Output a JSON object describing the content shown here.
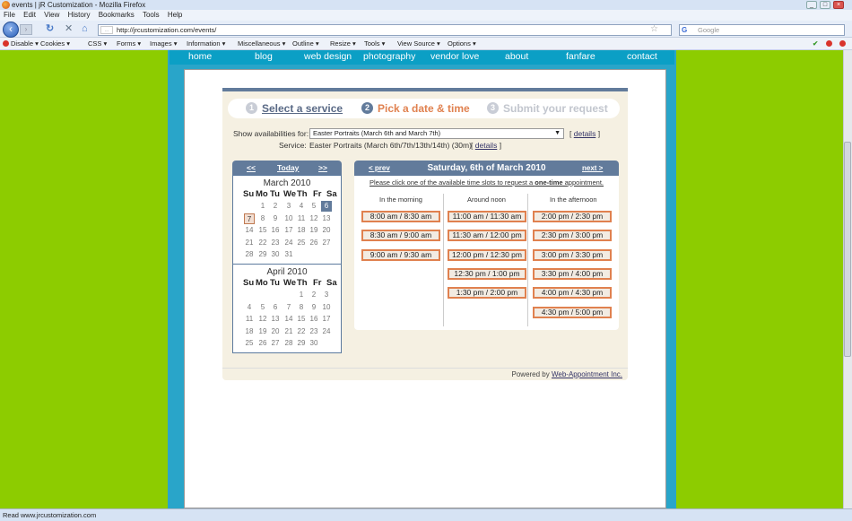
{
  "window": {
    "title": "events | jR Customization - Mozilla Firefox"
  },
  "menu": [
    "File",
    "Edit",
    "View",
    "History",
    "Bookmarks",
    "Tools",
    "Help"
  ],
  "nav": {
    "url": "http://jrcustomization.com/events/",
    "fav_label": "...",
    "search_placeholder": "Google",
    "search_engine_letter": "G"
  },
  "devbar": {
    "items": [
      "Disable",
      "Cookies",
      "CSS",
      "Forms",
      "Images",
      "Information",
      "Miscellaneous",
      "Outline",
      "Resize",
      "Tools",
      "View Source",
      "Options"
    ]
  },
  "site": {
    "nav": [
      "home",
      "blog",
      "web design",
      "photography",
      "vendor love",
      "about",
      "fanfare",
      "contact"
    ]
  },
  "steps": [
    {
      "num": "1",
      "label": "Select a service",
      "state": "done"
    },
    {
      "num": "2",
      "label": "Pick a date & time",
      "state": "current"
    },
    {
      "num": "3",
      "label": "Submit your request",
      "state": "todo"
    }
  ],
  "availability": {
    "show_label": "Show availabilities for:",
    "selected": "Easter Portraits (March 6th and March 7th)",
    "details_left": "[",
    "details_link": "details",
    "details_right": "]",
    "service_label": "Service:",
    "service_value": "Easter Portraits (March 6th/7th/13th/14th) (30m)",
    "service_details": "details"
  },
  "calendar": {
    "prev": "<<",
    "today": "Today",
    "next": ">>",
    "dow": [
      "Su",
      "Mo",
      "Tu",
      "We",
      "Th",
      "Fr",
      "Sa"
    ],
    "months": [
      {
        "name": "March 2010",
        "rows": [
          [
            "",
            "1",
            "2",
            "3",
            "4",
            "5",
            "6"
          ],
          [
            "7",
            "8",
            "9",
            "10",
            "11",
            "12",
            "13"
          ],
          [
            "14",
            "15",
            "16",
            "17",
            "18",
            "19",
            "20"
          ],
          [
            "21",
            "22",
            "23",
            "24",
            "25",
            "26",
            "27"
          ],
          [
            "28",
            "29",
            "30",
            "31",
            "",
            "",
            ""
          ]
        ]
      },
      {
        "name": "April 2010",
        "rows": [
          [
            "",
            "",
            "",
            "",
            "1",
            "2",
            "3"
          ],
          [
            "4",
            "5",
            "6",
            "7",
            "8",
            "9",
            "10"
          ],
          [
            "11",
            "12",
            "13",
            "14",
            "15",
            "16",
            "17"
          ],
          [
            "18",
            "19",
            "20",
            "21",
            "22",
            "23",
            "24"
          ],
          [
            "25",
            "26",
            "27",
            "28",
            "29",
            "30",
            ""
          ]
        ]
      }
    ],
    "selected_day": "6",
    "today_day": "7"
  },
  "slots": {
    "prev": "< prev",
    "next": "next >",
    "date": "Saturday, 6th of March 2010",
    "instruction_pre": "Please click one of the available time slots to request a ",
    "instruction_bold": "one-time",
    "instruction_post": " appointment.",
    "columns": [
      {
        "title": "In the morning",
        "slots": [
          "8:00 am / 8:30 am",
          "8:30 am / 9:00 am",
          "9:00 am / 9:30 am"
        ]
      },
      {
        "title": "Around noon",
        "slots": [
          "11:00 am / 11:30 am",
          "11:30 am / 12:00 pm",
          "12:00 pm / 12:30 pm",
          "12:30 pm / 1:00 pm",
          "1:30 pm / 2:00 pm"
        ]
      },
      {
        "title": "In the afternoon",
        "slots": [
          "2:00 pm / 2:30 pm",
          "2:30 pm / 3:00 pm",
          "3:00 pm / 3:30 pm",
          "3:30 pm / 4:00 pm",
          "4:00 pm / 4:30 pm",
          "4:30 pm / 5:00 pm"
        ]
      }
    ]
  },
  "footer": {
    "powered_label": "Powered by",
    "powered_link": "Web-Appointment Inc."
  },
  "status": {
    "text": "Read www.jrcustomization.com"
  },
  "colors": {
    "accent": "#627b9b",
    "site_green": "#8dcc00",
    "site_blue": "#0b9fc5",
    "slot_border": "#e0814f",
    "current_step": "#e0814f"
  }
}
